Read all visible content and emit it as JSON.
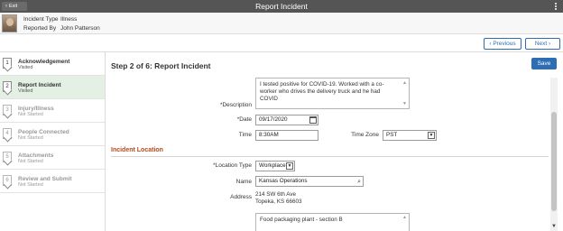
{
  "topbar": {
    "exit_label": "Exit",
    "title": "Report Incident"
  },
  "header": {
    "incident_type_label": "Incident Type",
    "incident_type_value": "Illness",
    "reported_by_label": "Reported By",
    "reported_by_value": "John Patterson"
  },
  "nav": {
    "previous_label": "Previous",
    "next_label": "Next"
  },
  "steps": [
    {
      "num": "1",
      "title": "Acknowledgement",
      "status": "Visited"
    },
    {
      "num": "2",
      "title": "Report Incident",
      "status": "Visited"
    },
    {
      "num": "3",
      "title": "Injury/Illness",
      "status": "Not Started"
    },
    {
      "num": "4",
      "title": "People Connected",
      "status": "Not Started"
    },
    {
      "num": "5",
      "title": "Attachments",
      "status": "Not Started"
    },
    {
      "num": "6",
      "title": "Review and Submit",
      "status": "Not Started"
    }
  ],
  "main": {
    "heading": "Step 2 of 6: Report Incident",
    "save_label": "Save",
    "description_label": "*Description",
    "description_value": "I tested positive for COVID-19.  Worked with a co-worker who drives the delivery truck and he had COVID",
    "date_label": "*Date",
    "date_value": "09/17/2020",
    "time_label": "Time",
    "time_value": "8:30AM",
    "timezone_label": "Time Zone",
    "timezone_value": "PST",
    "section_title": "Incident Location",
    "location_type_label": "*Location Type",
    "location_type_value": "Workplace",
    "name_label": "Name",
    "name_value": "Kansas Operations",
    "address_label": "Address",
    "address_line1": "214 SW 6th Ave",
    "address_line2": "Topeka, KS 66603",
    "location_desc_value": "Food packaging plant - section B"
  },
  "icons": {
    "exit": "chevron-left-icon",
    "menu": "kebab-menu-icon",
    "calendar": "calendar-icon",
    "search": "search-icon",
    "dropdown": "chevron-down-icon"
  },
  "colors": {
    "topbar": "#555555",
    "accent": "#2d6db4",
    "active_step": "#e3f0e3",
    "section_title": "#b24a1a"
  }
}
